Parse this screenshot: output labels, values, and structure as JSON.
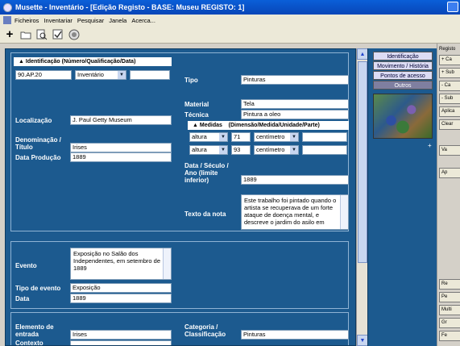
{
  "window": {
    "title": "Musette - Inventário - [Edição Registo - BASE: Museu REGISTO: 1]"
  },
  "menu": {
    "items": [
      "Ficheiros",
      "Inventariar",
      "Pesquisar",
      "Janela",
      "Acerca..."
    ]
  },
  "toolbar": {
    "add_symbol": "+"
  },
  "identificacao": {
    "header": "Identificação (Número/Qualificação/Data)",
    "number": "90.AP.20",
    "qualification": "Inventário",
    "date": ""
  },
  "localizacao": {
    "label": "Localização",
    "value": "J. Paul Getty Museum"
  },
  "denominacao": {
    "label": "Denominação / Título",
    "value": "Irises"
  },
  "data_producao": {
    "label": "Data Produção",
    "value": "1889"
  },
  "tipo": {
    "label": "Tipo",
    "value": "Pinturas"
  },
  "material": {
    "label": "Material",
    "value": "Tela"
  },
  "tecnica": {
    "label": "Técnica",
    "value": "Pintura a oleo"
  },
  "medidas": {
    "header_left": "Medidas",
    "header_right": "(Dimensão/Medida/Unidade/Parte)",
    "rows": [
      {
        "dimension": "altura",
        "value": "71",
        "unit": "centímetro",
        "part": ""
      },
      {
        "dimension": "altura",
        "value": "93",
        "unit": "centímetro",
        "part": ""
      }
    ]
  },
  "data_seculo": {
    "label": "Data / Século / Ano (limite inferior)",
    "value": "1889"
  },
  "texto_nota": {
    "label": "Texto da nota",
    "value": "Este trabalho foi pintado quando o artista se recuperava de um forte ataque de doença mental, e descreve o jardim do asilo em"
  },
  "evento": {
    "label": "Evento",
    "value": "Exposição no Salão dos Independentes, em setembro de 1889"
  },
  "tipo_evento": {
    "label": "Tipo de evento",
    "value": "Exposição"
  },
  "data_evento": {
    "label": "Data",
    "value": "1889"
  },
  "elemento_entrada": {
    "label": "Elemento de entrada",
    "value": "Irises"
  },
  "contexto": {
    "label": "Contexto",
    "value": ""
  },
  "categoria": {
    "label": "Categoria / Classificação",
    "value": "Pinturas"
  },
  "nav": {
    "identificacao": "Identificação",
    "movimento": "Movimento / História",
    "pontos": "Pontos de acesso",
    "outros": "Outros"
  },
  "right_panel": {
    "registo_label": "Registo",
    "buttons_top": [
      "+ Ca",
      "+ Sub",
      "- Ca",
      "- Sub",
      "Aplica",
      "Clear"
    ],
    "buttons_mid": [
      "Va",
      "Ap"
    ],
    "buttons_bottom": [
      "Re",
      "Pe",
      "Multi",
      "Gr",
      "Fe"
    ]
  },
  "colors": {
    "form_bg": "#1c5a8f",
    "title_bg": "#0a5fd8",
    "nav_active": "#7f7fa0"
  }
}
